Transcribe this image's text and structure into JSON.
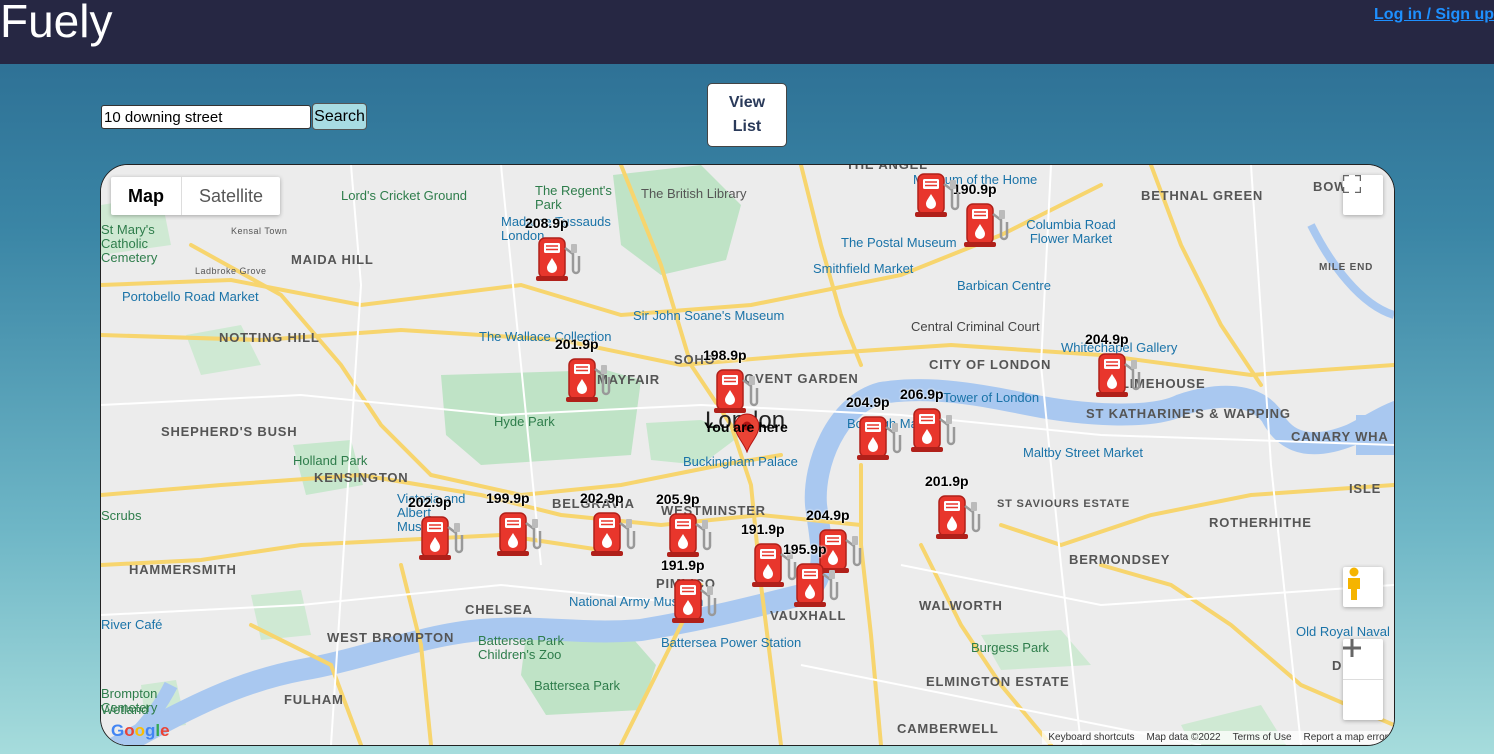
{
  "header": {
    "logo": "Fuely",
    "login_label": "Log in / Sign up"
  },
  "search": {
    "value": "10 downing street",
    "button_label": "Search"
  },
  "view_list": {
    "line1": "View",
    "line2": "List"
  },
  "map": {
    "type_map": "Map",
    "type_satellite": "Satellite",
    "city_label": "London",
    "you_are_here": "You are here",
    "footer": {
      "shortcuts": "Keyboard shortcuts",
      "data": "Map data ©2022",
      "terms": "Terms of Use",
      "report": "Report a map error"
    },
    "google": "Google",
    "areas": [
      "MAIDA HILL",
      "NOTTING HILL",
      "KENSINGTON",
      "SHEPHERD'S BUSH",
      "HAMMERSMITH",
      "CHELSEA",
      "WEST BROMPTON",
      "FULHAM",
      "MAYFAIR",
      "SOHO",
      "COVENT GARDEN",
      "CITY OF LONDON",
      "LIMEHOUSE",
      "ST KATHARINE'S & WAPPING",
      "CANARY WHA",
      "BELGRAVIA",
      "WESTMINSTER",
      "PIMLICO",
      "VAUXHALL",
      "WALWORTH",
      "BERMONDSEY",
      "ROTHERHITHE",
      "ELMINGTON ESTATE",
      "CAMBERWELL",
      "DEPTF",
      "BETHNAL GREEN",
      "BOW",
      "MILE END",
      "THE ANGEL",
      "ST SAVIOURS ESTATE",
      "ISLE"
    ],
    "places": [
      "Lord's Cricket Ground",
      "The Regent's Park",
      "The British Library",
      "Madame Tussauds London",
      "Kensal Town",
      "Ladbroke Grove",
      "Portobello Road Market",
      "The Wallace Collection",
      "Sir John Soane's Museum",
      "The Postal Museum",
      "Smithfield Market",
      "Barbican Centre",
      "Central Criminal Court",
      "Columbia Road Flower Market",
      "Museum of the Home",
      "Whitechapel Gallery",
      "Tower of London",
      "Borough Market",
      "Maltby Street Market",
      "Hyde Park",
      "Holland Park",
      "Buckingham Palace",
      "Victoria and Albert Museum",
      "National Army Museum",
      "Battersea Park Children's Zoo",
      "Battersea Power Station",
      "Battersea Park",
      "Burgess Park",
      "Old Royal Naval",
      "River Café",
      "St Mary's Catholic Cemetery",
      "Brompton Cemetery",
      "Wetland",
      "Scrubs"
    ],
    "stations": [
      {
        "price": "208.9p"
      },
      {
        "price": "190.9p"
      },
      {
        "price": "201.9p"
      },
      {
        "price": "198.9p"
      },
      {
        "price": "204.9p"
      },
      {
        "price": "206.9p"
      },
      {
        "price": "204.9p"
      },
      {
        "price": "201.9p"
      },
      {
        "price": "202.9p"
      },
      {
        "price": "199.9p"
      },
      {
        "price": "202.9p"
      },
      {
        "price": "205.9p"
      },
      {
        "price": "191.9p"
      },
      {
        "price": "204.9p"
      },
      {
        "price": "195.9p"
      },
      {
        "price": "191.9p"
      },
      {
        "price": ""
      }
    ]
  }
}
